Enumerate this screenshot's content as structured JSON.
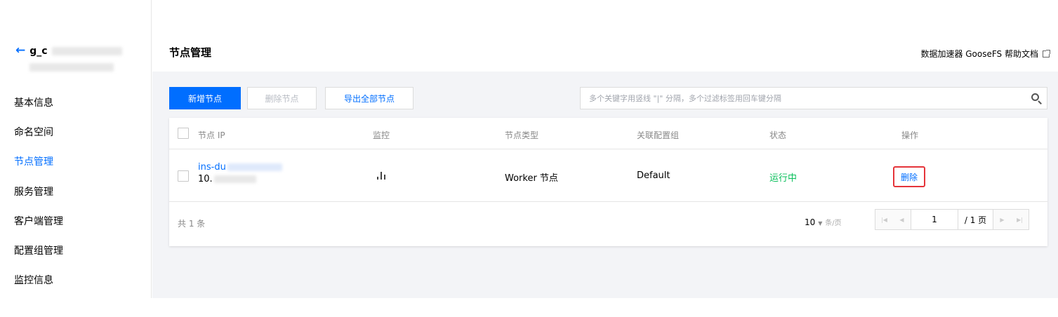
{
  "sidebar": {
    "back_icon": "arrow-left-icon",
    "instance_prefix": "g_c",
    "items": [
      {
        "label": "基本信息",
        "active": false
      },
      {
        "label": "命名空间",
        "active": false
      },
      {
        "label": "节点管理",
        "active": true
      },
      {
        "label": "服务管理",
        "active": false
      },
      {
        "label": "客户端管理",
        "active": false
      },
      {
        "label": "配置组管理",
        "active": false
      },
      {
        "label": "监控信息",
        "active": false
      }
    ]
  },
  "header": {
    "title": "节点管理",
    "help_link": "数据加速器 GooseFS 帮助文档",
    "help_icon": "external-link-icon"
  },
  "toolbar": {
    "add_label": "新增节点",
    "delete_label": "删除节点",
    "export_label": "导出全部节点",
    "search_placeholder": "多个关键字用竖线 \"|\" 分隔，多个过滤标签用回车键分隔",
    "search_icon": "search-icon"
  },
  "table": {
    "columns": [
      "节点 IP",
      "监控",
      "节点类型",
      "关联配置组",
      "状态",
      "操作"
    ],
    "rows": [
      {
        "node_name": "ins-du",
        "node_ip": "10.",
        "monitor_icon": "bar-chart-icon",
        "node_type": "Worker 节点",
        "config_group": "Default",
        "status": "运行中",
        "action": "删除"
      }
    ]
  },
  "pagination": {
    "total": "共 1 条",
    "page_size": "10",
    "page_size_unit": "条/页",
    "current_page": "1",
    "total_pages": "/ 1 页"
  },
  "colors": {
    "primary": "#006eff",
    "running": "#0abf5b",
    "highlight": "#e5343a"
  }
}
